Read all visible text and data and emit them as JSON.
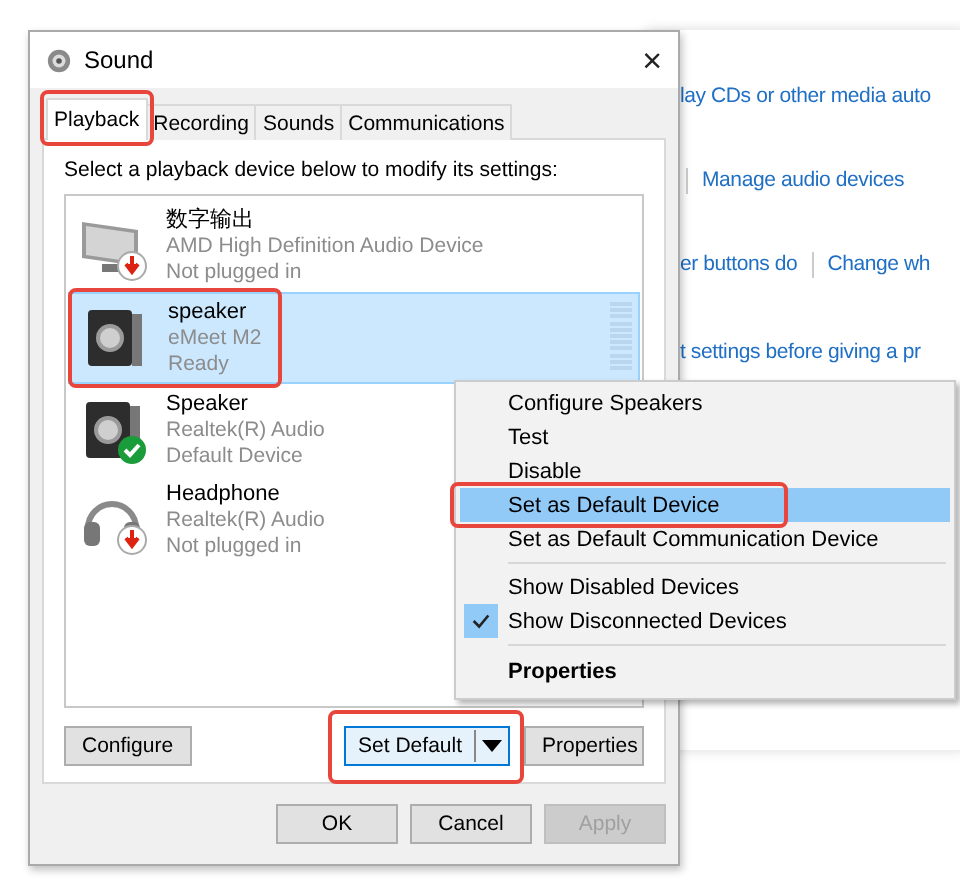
{
  "window": {
    "title": "Sound",
    "close": "×"
  },
  "tabs": [
    {
      "label": "Playback",
      "selected": true,
      "highlighted": true
    },
    {
      "label": "Recording",
      "selected": false,
      "highlighted": false
    },
    {
      "label": "Sounds",
      "selected": false,
      "highlighted": false
    },
    {
      "label": "Communications",
      "selected": false,
      "highlighted": false
    }
  ],
  "instruction": "Select a playback device below to modify its settings:",
  "devices": [
    {
      "name": "数字输出",
      "description": "AMD High Definition Audio Device",
      "status": "Not plugged in",
      "kind": "monitor",
      "unplugged": true,
      "is_default": false,
      "selected": false,
      "highlighted": false
    },
    {
      "name": "speaker",
      "description": "eMeet M2",
      "status": "Ready",
      "kind": "speaker",
      "unplugged": false,
      "is_default": false,
      "selected": true,
      "highlighted": true
    },
    {
      "name": "Speaker",
      "description": "Realtek(R) Audio",
      "status": "Default Device",
      "kind": "speaker",
      "unplugged": false,
      "is_default": true,
      "selected": false,
      "highlighted": false
    },
    {
      "name": "Headphone",
      "description": "Realtek(R) Audio",
      "status": "Not plugged in",
      "kind": "headphone",
      "unplugged": true,
      "is_default": false,
      "selected": false,
      "highlighted": false
    }
  ],
  "buttons": [
    {
      "label": "Configure",
      "kind": "plain",
      "highlighted": false
    },
    {
      "label": "Set Default",
      "kind": "split",
      "highlighted": true
    },
    {
      "label": "Properties",
      "kind": "plain",
      "highlighted": false
    }
  ],
  "dialog_buttons": [
    {
      "label": "OK",
      "disabled": false
    },
    {
      "label": "Cancel",
      "disabled": false
    },
    {
      "label": "Apply",
      "disabled": true
    }
  ],
  "background_window": {
    "rows": [
      {
        "leading_divider": false,
        "links": [
          "lay CDs or other media auto"
        ]
      },
      {
        "leading_divider": true,
        "links": [
          "Manage audio devices"
        ]
      },
      {
        "leading_divider": false,
        "links": [
          "er buttons do",
          "Change wh"
        ]
      },
      {
        "leading_divider": false,
        "links": [
          "t settings before giving a pr"
        ]
      }
    ]
  },
  "context_menu": {
    "items": [
      {
        "kind": "item",
        "label": "Configure Speakers",
        "selected": false,
        "checked": false,
        "highlighted": false
      },
      {
        "kind": "item",
        "label": "Test",
        "selected": false,
        "checked": false,
        "highlighted": false
      },
      {
        "kind": "item",
        "label": "Disable",
        "selected": false,
        "checked": false,
        "highlighted": false
      },
      {
        "kind": "item",
        "label": "Set as Default Device",
        "selected": true,
        "checked": false,
        "highlighted": true
      },
      {
        "kind": "item",
        "label": "Set as Default Communication Device",
        "selected": false,
        "checked": false,
        "highlighted": false
      },
      {
        "kind": "separator"
      },
      {
        "kind": "item",
        "label": "Show Disabled Devices",
        "selected": false,
        "checked": false,
        "highlighted": false
      },
      {
        "kind": "item",
        "label": "Show Disconnected Devices",
        "selected": false,
        "checked": true,
        "highlighted": false
      },
      {
        "kind": "separator"
      },
      {
        "kind": "default",
        "label": "Properties",
        "selected": false,
        "checked": false,
        "highlighted": false
      }
    ]
  }
}
